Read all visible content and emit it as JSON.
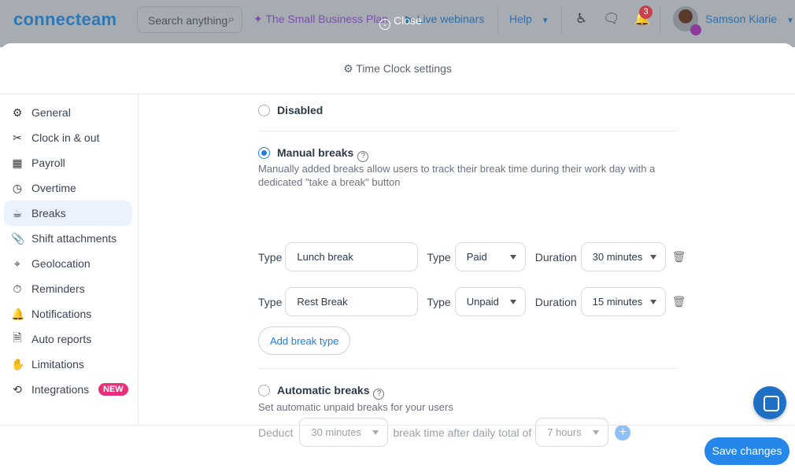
{
  "topbar": {
    "logo": "connecteam",
    "search_placeholder": "Search anything",
    "plan": "The Small Business Plan",
    "close": "Close",
    "webinars": "Live webinars",
    "help": "Help",
    "notifications_count": "3",
    "user": "Samson Kiarie"
  },
  "modal": {
    "title": "Time Clock settings"
  },
  "sidebar": {
    "items": [
      {
        "label": "General",
        "icon": "⚙"
      },
      {
        "label": "Clock in & out",
        "icon": "✂"
      },
      {
        "label": "Payroll",
        "icon": "▦"
      },
      {
        "label": "Overtime",
        "icon": "◷"
      },
      {
        "label": "Breaks",
        "icon": "☕"
      },
      {
        "label": "Shift attachments",
        "icon": "📎"
      },
      {
        "label": "Geolocation",
        "icon": "⌖"
      },
      {
        "label": "Reminders",
        "icon": "⏱"
      },
      {
        "label": "Notifications",
        "icon": "🔔"
      },
      {
        "label": "Auto reports",
        "icon": "🗎"
      },
      {
        "label": "Limitations",
        "icon": "✋"
      },
      {
        "label": "Integrations",
        "icon": "⟲"
      }
    ],
    "new_badge": "NEW",
    "active": "Breaks"
  },
  "breaks": {
    "disabled_label": "Disabled",
    "manual_label": "Manual breaks",
    "manual_desc": "Manually added breaks allow users to track their break time during their work day with a dedicated \"take a break\" button",
    "type_label": "Type",
    "duration_label": "Duration",
    "rows": [
      {
        "name": "Lunch break",
        "pay": "Paid",
        "duration": "30 minutes"
      },
      {
        "name": "Rest Break",
        "pay": "Unpaid",
        "duration": "15 minutes"
      }
    ],
    "add_label": "Add break type",
    "auto_label": "Automatic breaks",
    "auto_desc": "Set automatic unpaid breaks for your users",
    "deduct": "Deduct",
    "deduct_value": "30 minutes",
    "after": "break time after daily total of",
    "hours_value": "7 hours"
  },
  "footer": {
    "save": "Save changes"
  },
  "colors": {
    "accent": "#2687ea",
    "new_badge": "#e8307a"
  }
}
